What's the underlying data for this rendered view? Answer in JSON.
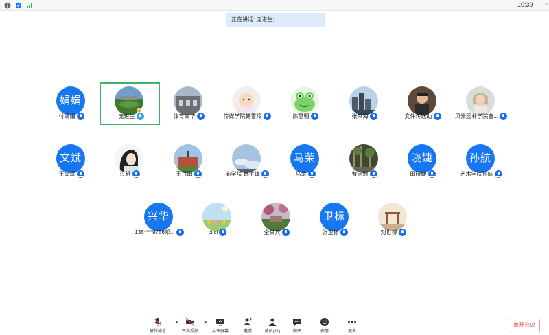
{
  "titlebar": {
    "time": "10:39"
  },
  "speaking": {
    "text": "正在讲话: 庞进生;"
  },
  "participants": [
    {
      "name": "付娟娟",
      "initials": "娟娟",
      "avatar": "text",
      "muted": true
    },
    {
      "name": "庞进生",
      "avatar": "photo-campus",
      "muted": false,
      "active": true
    },
    {
      "name": "体育高华",
      "avatar": "photo-building",
      "muted": true
    },
    {
      "name": "传媒学院韩雪玲",
      "avatar": "photo-baby",
      "muted": true
    },
    {
      "name": "陈慧明",
      "avatar": "photo-frog",
      "muted": true
    },
    {
      "name": "张书海",
      "avatar": "photo-city",
      "muted": true
    },
    {
      "name": "文件传送助",
      "avatar": "photo-man",
      "muted": true
    },
    {
      "name": "风景园林学院曹...",
      "avatar": "photo-woman",
      "muted": true
    },
    {
      "name": "王文斌",
      "initials": "文斌",
      "avatar": "text",
      "muted": true
    },
    {
      "name": "过轩",
      "avatar": "photo-girl",
      "muted": true
    },
    {
      "name": "王百田",
      "avatar": "photo-redbuilding",
      "muted": true
    },
    {
      "name": "商学院 韩宇锋",
      "avatar": "photo-sky",
      "muted": true
    },
    {
      "name": "马荣",
      "initials": "马荣",
      "avatar": "text",
      "muted": true
    },
    {
      "name": "曹志颖",
      "avatar": "photo-forest",
      "muted": true
    },
    {
      "name": "田晓婕",
      "initials": "晓婕",
      "avatar": "text",
      "muted": true
    },
    {
      "name": "艺术学院孙航",
      "initials": "孙航",
      "avatar": "text",
      "muted": true
    },
    {
      "name": "135****9756邓...",
      "initials": "兴华",
      "avatar": "text",
      "muted": true
    },
    {
      "name": "ci ci",
      "avatar": "photo-flowers",
      "muted": true
    },
    {
      "name": "仝其宾",
      "avatar": "photo-park",
      "muted": true
    },
    {
      "name": "张卫标",
      "initials": "卫标",
      "avatar": "text",
      "muted": true
    },
    {
      "name": "刘世博",
      "avatar": "photo-pavilion",
      "muted": true
    }
  ],
  "toolbar": {
    "unmute": "解除静音",
    "video": "开启视频",
    "share": "共享屏幕",
    "invite": "邀请",
    "members": "成员(21)",
    "chat": "聊天",
    "reactions": "表情",
    "more": "更多"
  },
  "leave": {
    "label": "离开会议"
  },
  "colors": {
    "accent": "#1677f0",
    "speaking_bg": "#deebfb",
    "active_border": "#3bb56b",
    "leave": "#e64545"
  }
}
